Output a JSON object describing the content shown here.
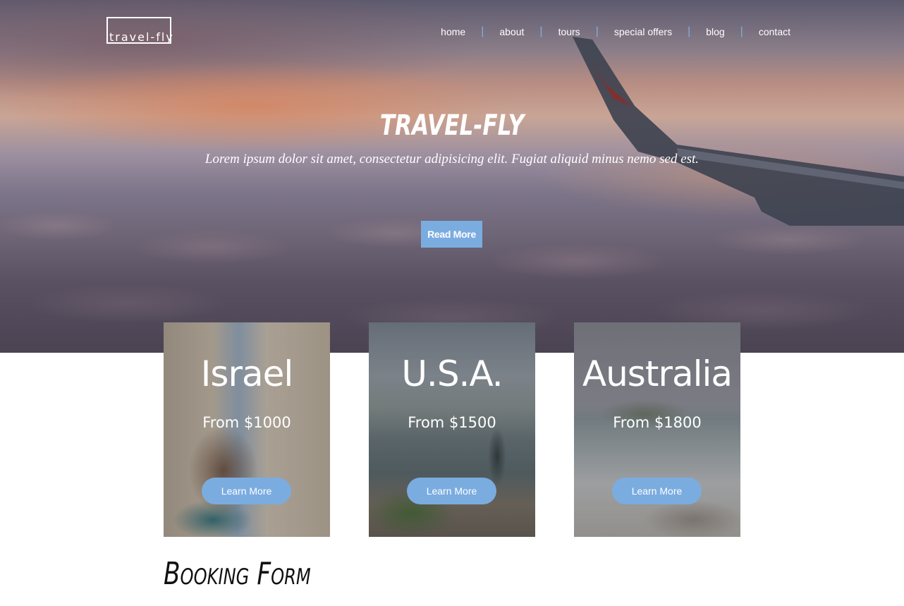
{
  "header": {
    "logo": "travel-fly",
    "nav": [
      {
        "label": "home"
      },
      {
        "label": "about"
      },
      {
        "label": "tours"
      },
      {
        "label": "special offers"
      },
      {
        "label": "blog"
      },
      {
        "label": "contact"
      }
    ],
    "separator": "|"
  },
  "hero": {
    "title": "TRAVEL-FLY",
    "subtitle": "Lorem ipsum dolor sit amet, consectetur adipisicing elit. Fugiat aliquid minus nemo sed est.",
    "button_label": "Read More"
  },
  "destinations": [
    {
      "name": "Israel",
      "price": "From $1000",
      "button_label": "Learn More"
    },
    {
      "name": "U.S.A.",
      "price": "From $1500",
      "button_label": "Learn More"
    },
    {
      "name": "Australia",
      "price": "From $1800",
      "button_label": "Learn More"
    }
  ],
  "booking": {
    "title": "Booking Form"
  },
  "colors": {
    "accent": "#7bace0",
    "text_light": "#ffffff",
    "text_dark": "#111111"
  },
  "icons": {
    "hero_image": "airplane-wing-over-clouds",
    "israel_image": "woman-photographing-arches",
    "usa_image": "hiker-on-rocky-shore",
    "australia_image": "person-on-coastal-rocks"
  }
}
